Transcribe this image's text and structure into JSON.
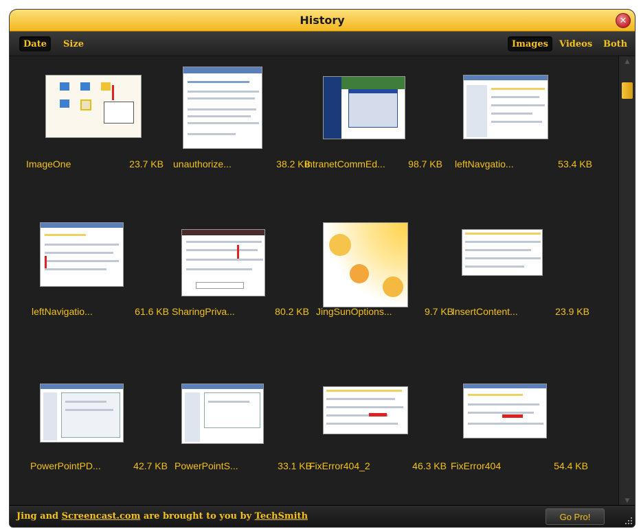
{
  "window": {
    "title": "History"
  },
  "toolbar": {
    "sort": [
      {
        "label": "Date",
        "active": true
      },
      {
        "label": "Size",
        "active": false
      }
    ],
    "filters": [
      {
        "label": "Images",
        "active": true
      },
      {
        "label": "Videos",
        "active": false
      },
      {
        "label": "Both",
        "active": false
      }
    ]
  },
  "items": [
    {
      "name": "ImageOne",
      "size": "23.7 KB"
    },
    {
      "name": "unauthorize...",
      "size": "38.2 KB"
    },
    {
      "name": "intranetCommEd...",
      "size": "98.7 KB"
    },
    {
      "name": "leftNavgatio...",
      "size": "53.4 KB"
    },
    {
      "name": "leftNavigatio...",
      "size": "61.6 KB"
    },
    {
      "name": "SharingPriva...",
      "size": "80.2 KB"
    },
    {
      "name": "JingSunOptions...",
      "size": "9.7 KB"
    },
    {
      "name": "InsertContent...",
      "size": "23.9 KB"
    },
    {
      "name": "PowerPointPD...",
      "size": "42.7 KB"
    },
    {
      "name": "PowerPointS...",
      "size": "33.1 KB"
    },
    {
      "name": "FixError404_2",
      "size": "46.3 KB"
    },
    {
      "name": "FixError404",
      "size": "54.4 KB"
    }
  ],
  "footer": {
    "text_prefix": "Jing and ",
    "link1": "Screencast.com",
    "text_middle": " are brought to you by ",
    "link2": "TechSmith",
    "gopro_label": "Go Pro!"
  },
  "colors": {
    "accent": "#f3c11b",
    "titlebar": "#f2b71e",
    "background": "#1f1f1f"
  },
  "icons": {
    "close": "close-icon",
    "resize": "resize-grip-icon"
  }
}
